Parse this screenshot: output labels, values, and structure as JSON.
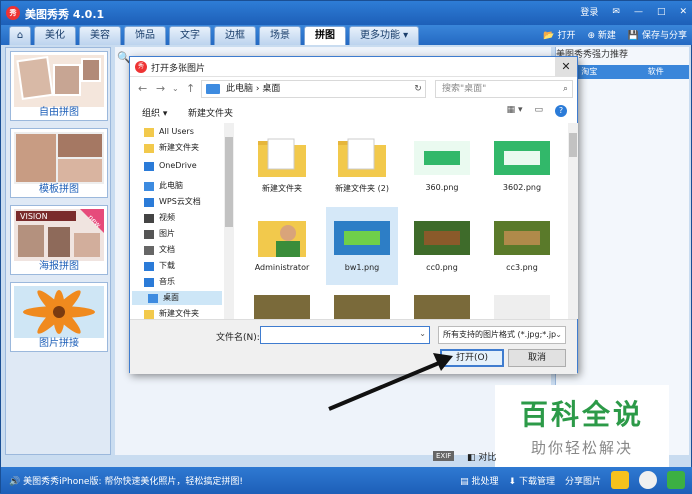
{
  "app": {
    "title": "美图秀秀 4.0.1",
    "logo": "秀"
  },
  "titlebar": {
    "login": "登录",
    "minimize": "—",
    "restore": "□",
    "close": "✕"
  },
  "tabs": [
    "美化",
    "美容",
    "饰品",
    "文字",
    "边框",
    "场景",
    "拼图",
    "更多功能 ▾"
  ],
  "active_tab": "拼图",
  "tabbar_right": {
    "open": "打开",
    "new": "新建",
    "save": "保存与分享"
  },
  "sidebar": {
    "items": [
      {
        "label": "自由拼图"
      },
      {
        "label": "模板拼图"
      },
      {
        "label": "海报拼图",
        "badge": "new"
      },
      {
        "label": "图片拼接"
      }
    ]
  },
  "right_panel": {
    "title": "美图秀秀强力推荐",
    "tabs": [
      "淘宝",
      "软件"
    ]
  },
  "dialog": {
    "title": "打开多张图片",
    "path": [
      "此电脑",
      "桌面"
    ],
    "search_placeholder": "搜索\"桌面\"",
    "organize": "组织 ▾",
    "new_folder": "新建文件夹",
    "nav_items": [
      {
        "label": "All Users",
        "icon": "folder-icon"
      },
      {
        "label": "新建文件夹",
        "icon": "folder-icon"
      },
      {
        "label": "OneDrive",
        "icon": "cloud-icon"
      },
      {
        "label": "此电脑",
        "icon": "computer-icon"
      },
      {
        "label": "WPS云文档",
        "icon": "cloud-icon"
      },
      {
        "label": "视频",
        "icon": "video-icon"
      },
      {
        "label": "图片",
        "icon": "image-icon"
      },
      {
        "label": "文档",
        "icon": "document-icon"
      },
      {
        "label": "下载",
        "icon": "download-icon"
      },
      {
        "label": "音乐",
        "icon": "music-icon"
      },
      {
        "label": "桌面",
        "icon": "desktop-icon",
        "selected": true
      },
      {
        "label": "新建文件夹",
        "icon": "folder-icon"
      }
    ],
    "files": [
      {
        "label": "新建文件夹",
        "kind": "folder"
      },
      {
        "label": "新建文件夹 (2)",
        "kind": "folder"
      },
      {
        "label": "360.png",
        "kind": "image"
      },
      {
        "label": "3602.png",
        "kind": "image"
      },
      {
        "label": "Administrator",
        "kind": "user"
      },
      {
        "label": "bw1.png",
        "kind": "image",
        "selected": true
      },
      {
        "label": "cc0.png",
        "kind": "image"
      },
      {
        "label": "cc3.png",
        "kind": "image"
      }
    ],
    "filename_label": "文件名(N):",
    "filename_value": "",
    "filetype": "所有支持的图片格式 (*.jpg;*.jp",
    "open_button": "打开(O)",
    "cancel_button": "取消"
  },
  "watermark": {
    "line1": "百科全说",
    "line2": "助你轻松解决"
  },
  "status": {
    "message": "美图秀秀iPhone版: 帮你快速美化照片，轻松搞定拼图!",
    "batch": "批处理",
    "download": "下载管理",
    "share": "分享图片",
    "exif": "EXIF",
    "compare": "对比"
  },
  "colors": {
    "brand_blue": "#1d5fb8",
    "watermark_green": "#2c9a48",
    "dialog_border": "#3f7ccf"
  }
}
